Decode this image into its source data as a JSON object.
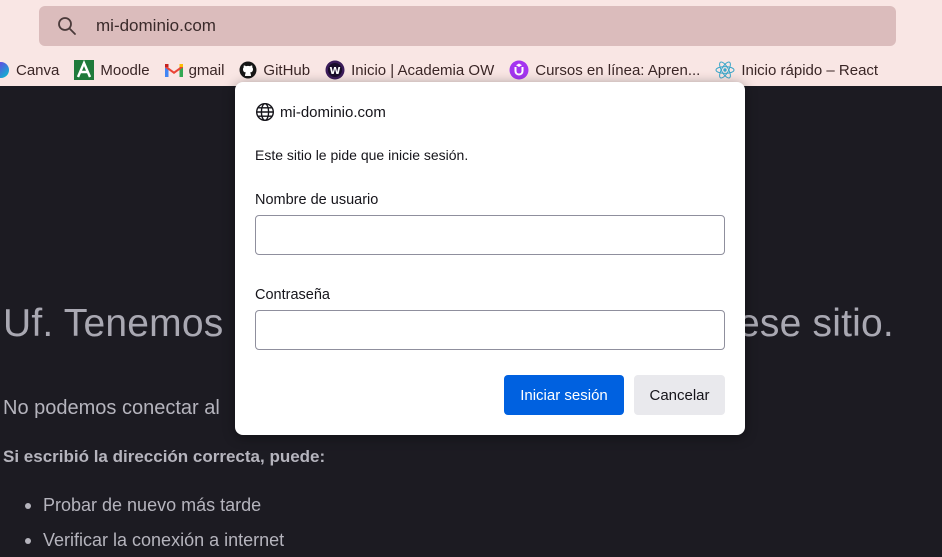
{
  "browser": {
    "url": "mi-dominio.com",
    "bookmarks": [
      {
        "label": "Canva",
        "icon": "canva-icon"
      },
      {
        "label": "Moodle",
        "icon": "moodle-icon"
      },
      {
        "label": "gmail",
        "icon": "gmail-icon"
      },
      {
        "label": "GitHub",
        "icon": "github-icon"
      },
      {
        "label": "Inicio | Academia OW",
        "icon": "academia-ow-icon"
      },
      {
        "label": "Cursos en línea: Apren...",
        "icon": "cursos-icon"
      },
      {
        "label": "Inicio rápido – React",
        "icon": "react-icon"
      }
    ]
  },
  "error_page": {
    "title_left": "Uf. Tenemos",
    "title_right": "ese sitio.",
    "subtitle": "No podemos conectar al",
    "bold_line": "Si escribió la dirección correcta, puede:",
    "suggestions": [
      "Probar de nuevo más tarde",
      "Verificar la conexión a internet"
    ]
  },
  "dialog": {
    "site": "mi-dominio.com",
    "message": "Este sitio le pide que inicie sesión.",
    "username_label": "Nombre de usuario",
    "username_value": "",
    "password_label": "Contraseña",
    "password_value": "",
    "submit_label": "Iniciar sesión",
    "cancel_label": "Cancelar"
  },
  "colors": {
    "toolbar_bg": "#f9e6e4",
    "urlbar_bg": "#dbbcbc",
    "page_bg": "#1c1b22",
    "primary_button": "#0061e0"
  }
}
